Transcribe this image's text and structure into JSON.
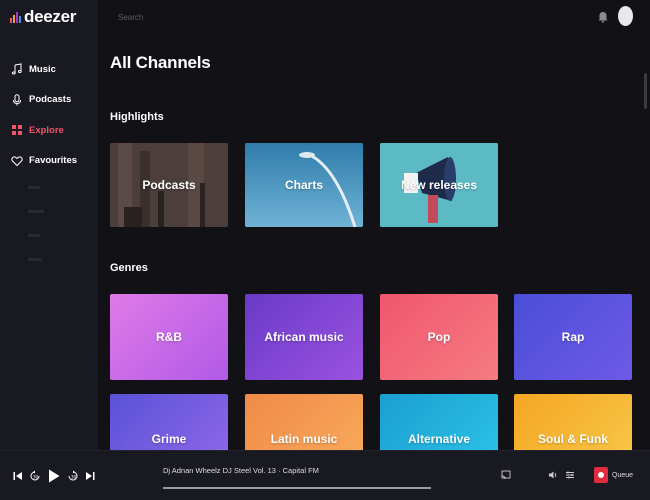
{
  "app": {
    "logo_text": "deezer",
    "logo_bar_colors": [
      "#ef5466",
      "#f2a03d",
      "#a239ca",
      "#4a90e2",
      "#33c07a"
    ]
  },
  "sidebar": {
    "items": [
      {
        "label": "Music",
        "icon": "music-note-icon",
        "active": false
      },
      {
        "label": "Podcasts",
        "icon": "microphone-icon",
        "active": false
      },
      {
        "label": "Explore",
        "icon": "grid-icon",
        "active": true
      },
      {
        "label": "Favourites",
        "icon": "heart-icon",
        "active": false
      }
    ]
  },
  "topbar": {
    "search_placeholder": "Search",
    "bell_icon": "bell-icon",
    "avatar_icon": "avatar"
  },
  "main": {
    "title": "All Channels",
    "highlights_title": "Highlights",
    "highlights": [
      {
        "label": "Podcasts",
        "color": "#4a3c38"
      },
      {
        "label": "Charts",
        "color": "#3d8bb6"
      },
      {
        "label": "New releases",
        "color": "#58b6c0"
      }
    ],
    "genres_title": "Genres",
    "genres": [
      {
        "label": "R&B",
        "from": "#e07ae8",
        "to": "#b05ae6"
      },
      {
        "label": "African music",
        "from": "#6a3ac8",
        "to": "#9a52e0"
      },
      {
        "label": "Pop",
        "from": "#f0566e",
        "to": "#f57b82"
      },
      {
        "label": "Rap",
        "from": "#4a4ed8",
        "to": "#6e5ae6"
      },
      {
        "label": "Grime",
        "from": "#5a52d6",
        "to": "#8c66e8"
      },
      {
        "label": "Latin music",
        "from": "#f08a48",
        "to": "#f7a85a"
      },
      {
        "label": "Alternative",
        "from": "#1a9fd0",
        "to": "#2bc0e6"
      },
      {
        "label": "Soul & Funk",
        "from": "#f5a623",
        "to": "#f7c545"
      }
    ]
  },
  "player": {
    "track_text": "Dj Adnan Wheelz DJ Steel Vol. 13 · Capital FM",
    "queue_label": "Queue",
    "progress_percent": 100
  }
}
